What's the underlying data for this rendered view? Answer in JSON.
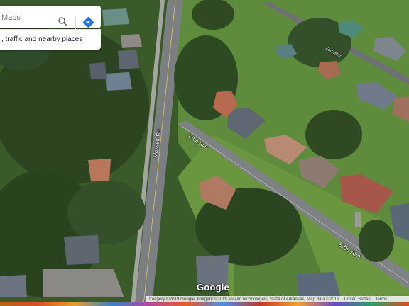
{
  "search": {
    "title_fragment": "Maps",
    "suggestion": ", traffic and nearby places"
  },
  "roads": {
    "left_road": "Massett Rd",
    "elbow_top": "Elbe Ave",
    "elbow_bottom": "Elbe Ave",
    "far_road": "Forrester"
  },
  "footer": {
    "logo": "Google",
    "imagery": "Imagery ©2019 Google, Imagery ©2019 Maxar Technologies, State of Arkansas, Map data ©2019",
    "country": "United States",
    "terms": "Terms"
  },
  "colors": {
    "trees": "#2f4a22",
    "lawn": "#5c8a3a",
    "road": "#7a7d80",
    "roof_brown": "#b06a4a",
    "roof_gray": "#6b7480"
  },
  "icons": [
    "search-icon",
    "directions-icon"
  ]
}
